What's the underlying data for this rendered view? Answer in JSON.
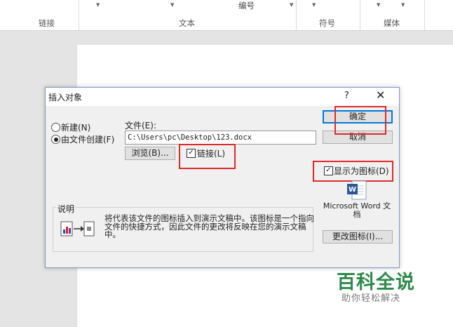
{
  "ribbon": {
    "groups": [
      "链接",
      "文本",
      "符号",
      "媒体"
    ],
    "top_label": "编号"
  },
  "dialog": {
    "title": "插入对象",
    "help": "?",
    "close": "✕",
    "radio_new": "新建(N)",
    "radio_from_file": "由文件创建(F)",
    "file_label": "文件(E):",
    "file_path": "C:\\Users\\pc\\Desktop\\123.docx",
    "browse": "浏览(B)...",
    "link": "链接(L)",
    "ok": "确定",
    "cancel": "取消",
    "display_as_icon": "显示为图标(D)",
    "icon_caption": "Microsoft Word 文档",
    "change_icon": "更改图标(I)...",
    "result_title": "说明",
    "result_text": "将代表该文件的图标插入到演示文稿中。该图标是一个指向文件的快捷方式，因此文件的更改将反映在您的演示文稿中。"
  },
  "watermark": {
    "main": "百科全说",
    "sub": "助你轻松解决"
  },
  "colors": {
    "accent": "#0078d7",
    "highlight": "#e02a2a",
    "brand": "#2d8a4a"
  }
}
